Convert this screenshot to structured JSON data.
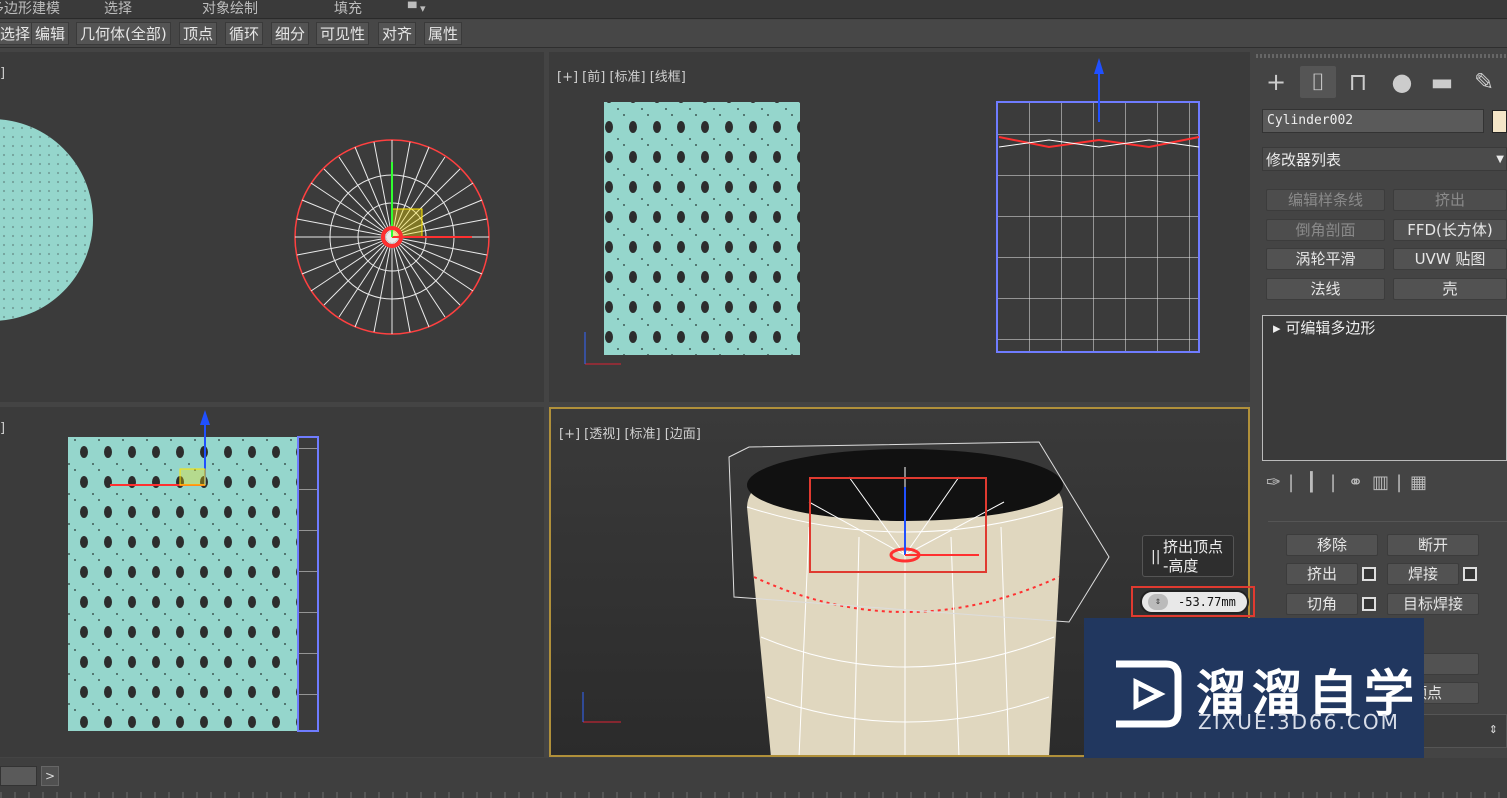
{
  "menubar": {
    "items": [
      "多边形建模",
      "选择",
      "对象绘制",
      "填充"
    ]
  },
  "ribbon": {
    "tabs": [
      "选择",
      "编辑",
      "几何体(全部)",
      "顶点",
      "循环",
      "细分",
      "可见性",
      "对齐",
      "属性"
    ]
  },
  "viewports": {
    "top_left_label": "]",
    "top_right_label": "[+] [前] [标准] [线框]",
    "bottom_left_label": "]",
    "bottom_right_label": "[+] [透视] [标准] [边面]"
  },
  "tooltip": {
    "line1": "挤出顶点",
    "line2": "-高度"
  },
  "spinner": {
    "value": "-53.77mm"
  },
  "command_panel": {
    "tabs": [
      "create-icon",
      "modify-icon",
      "hierarchy-icon",
      "motion-icon",
      "display-icon",
      "utilities-icon"
    ],
    "object_name": "Cylinder002",
    "modifier_list": "修改器列表",
    "modifier_buttons": [
      {
        "label": "编辑样条线",
        "enabled": false
      },
      {
        "label": "挤出",
        "enabled": false
      },
      {
        "label": "倒角剖面",
        "enabled": false
      },
      {
        "label": "FFD(长方体)",
        "enabled": true
      },
      {
        "label": "涡轮平滑",
        "enabled": true
      },
      {
        "label": "UVW 贴图",
        "enabled": true
      },
      {
        "label": "法线",
        "enabled": true
      },
      {
        "label": "壳",
        "enabled": true
      }
    ],
    "stack_item": "可编辑多边形",
    "edit_buttons": [
      "移除",
      "断开",
      "挤出",
      "焊接",
      "切角",
      "目标焊接"
    ],
    "partial_buttons": [
      "点",
      "顶点"
    ],
    "object_color": "#f5e6c8"
  },
  "watermark": {
    "chinese": "溜溜自学",
    "url": "ZIXUE.3D66.COM"
  }
}
